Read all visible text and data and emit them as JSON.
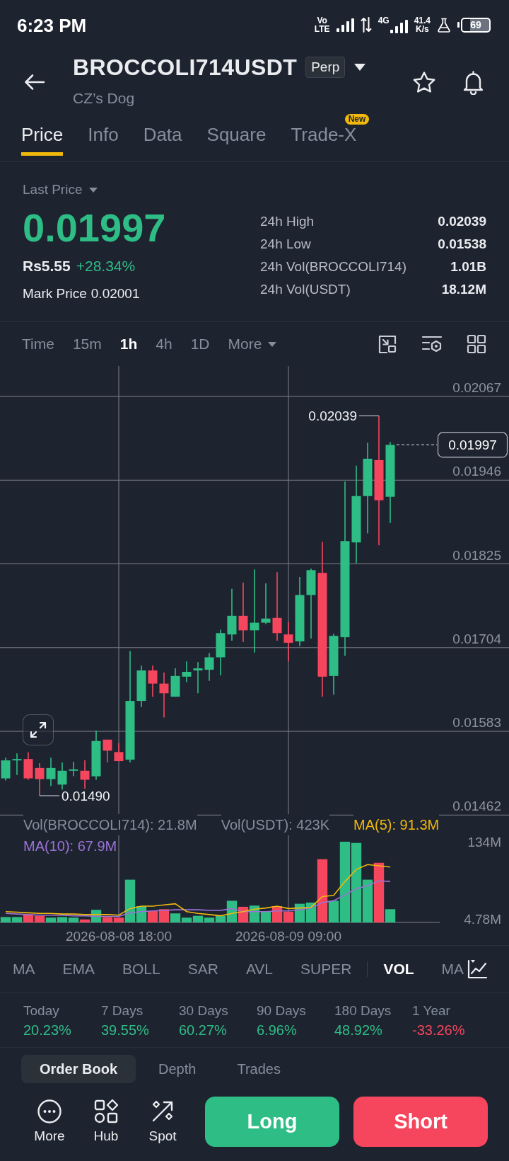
{
  "status_bar": {
    "time": "6:23 PM",
    "volte_top": "Vo",
    "volte_bottom": "LTE",
    "network_type": "4G",
    "speed_value": "41.4",
    "speed_unit": "K/s",
    "battery": "69"
  },
  "header": {
    "title": "BROCCOLI714USDT",
    "badge": "Perp",
    "subtitle": "CZ’s Dog"
  },
  "tabs": [
    {
      "label": "Price",
      "selected": true
    },
    {
      "label": "Info",
      "selected": false
    },
    {
      "label": "Data",
      "selected": false
    },
    {
      "label": "Square",
      "selected": false
    },
    {
      "label": "Trade-X",
      "selected": false,
      "badge": "New"
    }
  ],
  "price_panel": {
    "price_type": "Last Price",
    "last_price": "0.01997",
    "local_price": "Rs5.55",
    "change": "+28.34%",
    "mark_price_label": "Mark Price",
    "mark_price": "0.02001",
    "stats": [
      {
        "label": "24h High",
        "value": "0.02039"
      },
      {
        "label": "24h Low",
        "value": "0.01538"
      },
      {
        "label": "24h Vol(BROCCOLI714)",
        "value": "1.01B"
      },
      {
        "label": "24h Vol(USDT)",
        "value": "18.12M"
      }
    ]
  },
  "intervals": [
    {
      "label": "Time",
      "kind": "option",
      "selected": false
    },
    {
      "label": "15m",
      "kind": "option",
      "selected": false
    },
    {
      "label": "1h",
      "kind": "option",
      "selected": true
    },
    {
      "label": "4h",
      "kind": "option",
      "selected": false
    },
    {
      "label": "1D",
      "kind": "option",
      "selected": false
    },
    {
      "label": "More",
      "kind": "menu",
      "selected": false
    }
  ],
  "price_chart": {
    "chart_data": {
      "type": "candlestick",
      "categories": [
        null,
        null,
        null,
        null,
        null,
        null,
        null,
        null,
        null,
        null,
        null,
        null,
        null,
        null,
        null,
        null,
        null,
        null,
        null,
        null,
        null,
        null,
        null,
        null,
        null,
        null,
        null,
        null,
        null,
        null,
        null,
        null,
        null,
        null,
        null,
        null,
        null,
        null,
        null,
        null,
        null,
        null,
        null,
        null,
        null
      ],
      "ohlc": [
        [
          0.01515,
          0.01545,
          0.01512,
          0.01541
        ],
        [
          0.01541,
          0.01551,
          0.0152,
          0.01543
        ],
        [
          0.01543,
          0.01553,
          0.01513,
          0.01515
        ],
        [
          0.0153,
          0.01537,
          0.0149,
          0.01514
        ],
        [
          0.01514,
          0.01545,
          0.01504,
          0.0153
        ],
        [
          0.01506,
          0.01538,
          0.01499,
          0.01526
        ],
        [
          0.01526,
          0.01539,
          0.01518,
          0.01528
        ],
        [
          0.01526,
          0.01541,
          0.015,
          0.01513
        ],
        [
          0.01518,
          0.01584,
          0.01513,
          0.01569
        ],
        [
          0.01571,
          0.01571,
          0.01538,
          0.01555
        ],
        [
          0.01553,
          0.01566,
          0.0154,
          0.0154
        ],
        [
          0.01542,
          0.01699,
          0.01538,
          0.01627
        ],
        [
          0.01627,
          0.01678,
          0.01618,
          0.01671
        ],
        [
          0.01671,
          0.01678,
          0.01633,
          0.01652
        ],
        [
          0.01652,
          0.01668,
          0.01603,
          0.01638
        ],
        [
          0.01633,
          0.01674,
          0.01633,
          0.01663
        ],
        [
          0.01662,
          0.01684,
          0.01654,
          0.01669
        ],
        [
          0.01671,
          0.01683,
          0.01638,
          0.01674
        ],
        [
          0.01672,
          0.01696,
          0.01656,
          0.0169
        ],
        [
          0.0169,
          0.0173,
          0.01664,
          0.01725
        ],
        [
          0.01723,
          0.01789,
          0.01714,
          0.0175
        ],
        [
          0.0175,
          0.01798,
          0.01712,
          0.01729
        ],
        [
          0.01729,
          0.01817,
          0.01697,
          0.0174
        ],
        [
          0.0174,
          0.01797,
          0.01738,
          0.01746
        ],
        [
          0.01747,
          0.01813,
          0.01714,
          0.01725
        ],
        [
          0.01723,
          0.01741,
          0.01684,
          0.01711
        ],
        [
          0.01713,
          0.01806,
          0.01706,
          0.0178
        ],
        [
          0.0178,
          0.01818,
          0.01717,
          0.01816
        ],
        [
          0.01812,
          0.01857,
          0.01633,
          0.01662
        ],
        [
          0.01663,
          0.01724,
          0.01636,
          0.01721
        ],
        [
          0.01719,
          0.01944,
          0.01692,
          0.01858
        ],
        [
          0.01856,
          0.01967,
          0.01826,
          0.01923
        ],
        [
          0.01923,
          0.02,
          0.01869,
          0.01977
        ],
        [
          0.01975,
          0.02039,
          0.01852,
          0.01917
        ],
        [
          0.01922,
          0.02001,
          0.01884,
          0.01997
        ],
        null,
        null,
        null,
        null,
        null,
        null,
        null,
        null,
        null,
        null
      ],
      "ylim": [
        0.01448,
        0.02111
      ],
      "yticks": [
        0.02067,
        0.01946,
        0.01825,
        0.01704,
        0.01583,
        0.01462
      ],
      "grid": true,
      "annotations": [
        "0.02039",
        "0.01490",
        "0.01997"
      ]
    }
  },
  "volume_panel": {
    "legend": [
      {
        "text": "Vol(BROCCOLI714): 21.8M",
        "color": "#848e9c"
      },
      {
        "text": "Vol(USDT): 423K",
        "color": "#848e9c"
      },
      {
        "text": "MA(5): 91.3M",
        "color": "#f0b90b"
      },
      {
        "text": "MA(10): 67.9M",
        "color": "#9b72d6"
      }
    ],
    "chart_data": {
      "type": "bar",
      "categories": [
        null,
        null,
        null,
        null,
        null,
        null,
        null,
        null,
        null,
        null,
        "2026-08-08 18:00",
        null,
        null,
        null,
        null,
        null,
        null,
        null,
        null,
        null,
        null,
        null,
        null,
        null,
        null,
        "2026-08-09 09:00",
        null,
        null,
        null,
        null,
        null,
        null,
        null,
        null,
        null,
        null,
        null,
        null,
        null,
        null,
        null,
        null,
        null,
        null,
        null
      ],
      "series": [
        {
          "type": "bar",
          "values": [
            9,
            9,
            13,
            11,
            8,
            9,
            8,
            5,
            21,
            9,
            8,
            71,
            27,
            19,
            22,
            15,
            8,
            11,
            8,
            11,
            36,
            26,
            28,
            18,
            27,
            18,
            31,
            33,
            105,
            36,
            134,
            132,
            71,
            99,
            22,
            null,
            null,
            null,
            null,
            null,
            null,
            null,
            null,
            null,
            null
          ],
          "colors": [
            "#2ebd85",
            "#2ebd85",
            "#f6465d",
            "#f6465d",
            "#2ebd85",
            "#2ebd85",
            "#2ebd85",
            "#f6465d",
            "#2ebd85",
            "#f6465d",
            "#f6465d",
            "#2ebd85",
            "#2ebd85",
            "#f6465d",
            "#f6465d",
            "#2ebd85",
            "#2ebd85",
            "#2ebd85",
            "#2ebd85",
            "#2ebd85",
            "#2ebd85",
            "#f6465d",
            "#2ebd85",
            "#2ebd85",
            "#f6465d",
            "#f6465d",
            "#2ebd85",
            "#2ebd85",
            "#f6465d",
            "#2ebd85",
            "#2ebd85",
            "#2ebd85",
            "#2ebd85",
            "#f6465d",
            "#2ebd85",
            null,
            null,
            null,
            null,
            null,
            null,
            null,
            null,
            null,
            null
          ]
        },
        {
          "type": "line",
          "color": "#9b72d6",
          "values": [
            15,
            14,
            13,
            12,
            12,
            12,
            11,
            11,
            10,
            10,
            10,
            16,
            18,
            19,
            20,
            21,
            21,
            21,
            20,
            20,
            23,
            18,
            18,
            18,
            19,
            19,
            21,
            24,
            33,
            36,
            46,
            56,
            61,
            69,
            68,
            null,
            null,
            null,
            null,
            null,
            null,
            null,
            null,
            null,
            null
          ]
        },
        {
          "type": "line",
          "color": "#f0b90b",
          "values": [
            18,
            17,
            16,
            15,
            15,
            14,
            14,
            13,
            13,
            13,
            12,
            23,
            27,
            27,
            29,
            31,
            18,
            15,
            13,
            11,
            15,
            18,
            22,
            24,
            27,
            23,
            24,
            25,
            43,
            45,
            68,
            88,
            96,
            94,
            92,
            null,
            null,
            null,
            null,
            null,
            null,
            null,
            null,
            null,
            null
          ]
        }
      ],
      "ylim": [
        0,
        134
      ],
      "yticks": [
        {
          "value": 134,
          "label": "134M"
        },
        {
          "value": 4.78,
          "label": "4.78M"
        }
      ],
      "grid": true
    }
  },
  "indicators": [
    {
      "label": "MA",
      "divider_before": false,
      "selected": false
    },
    {
      "label": "EMA",
      "divider_before": false,
      "selected": false
    },
    {
      "label": "BOLL",
      "divider_before": false,
      "selected": false
    },
    {
      "label": "SAR",
      "divider_before": false,
      "selected": false
    },
    {
      "label": "AVL",
      "divider_before": false,
      "selected": false
    },
    {
      "label": "SUPER",
      "divider_before": false,
      "selected": false
    },
    {
      "label": "VOL",
      "divider_before": true,
      "selected": true
    },
    {
      "label": "MA",
      "divider_before": false,
      "selected": false
    }
  ],
  "returns": [
    {
      "period": "Today",
      "value": "20.23%",
      "color": "#2ebd85"
    },
    {
      "period": "7 Days",
      "value": "39.55%",
      "color": "#2ebd85"
    },
    {
      "period": "30 Days",
      "value": "60.27%",
      "color": "#2ebd85"
    },
    {
      "period": "90 Days",
      "value": "6.96%",
      "color": "#2ebd85"
    },
    {
      "period": "180 Days",
      "value": "48.92%",
      "color": "#2ebd85"
    },
    {
      "period": "1 Year",
      "value": "-33.26%",
      "color": "#f6465d"
    }
  ],
  "book_tabs": [
    {
      "label": "Order Book",
      "selected": true
    },
    {
      "label": "Depth",
      "selected": false
    },
    {
      "label": "Trades",
      "selected": false
    }
  ],
  "bottom_nav": {
    "items": [
      {
        "label": "More"
      },
      {
        "label": "Hub"
      },
      {
        "label": "Spot"
      }
    ],
    "actions": [
      {
        "label": "Long",
        "kind": "buy"
      },
      {
        "label": "Short",
        "kind": "sell"
      }
    ]
  }
}
